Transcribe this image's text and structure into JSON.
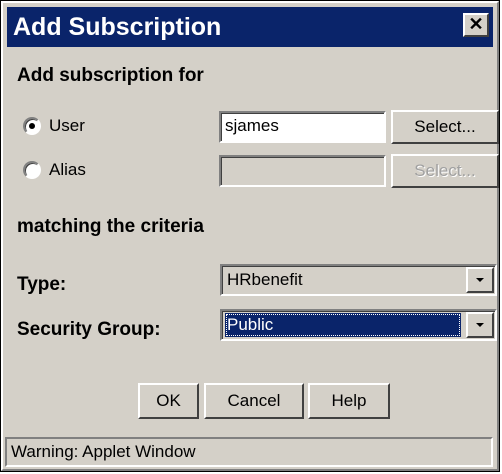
{
  "window": {
    "title": "Add Subscription",
    "close_glyph": "✕"
  },
  "section_add": {
    "heading": "Add subscription for"
  },
  "user_option": {
    "label": "User",
    "selected": true,
    "value": "sjames",
    "select_label": "Select..."
  },
  "alias_option": {
    "label": "Alias",
    "selected": false,
    "value": "",
    "select_label": "Select...",
    "enabled": false
  },
  "section_criteria": {
    "heading": "matching the criteria"
  },
  "type": {
    "label": "Type:",
    "value": "HRbenefit"
  },
  "security_group": {
    "label": "Security Group:",
    "value": "Public",
    "focused": true
  },
  "buttons": {
    "ok": "OK",
    "cancel": "Cancel",
    "help": "Help"
  },
  "status": {
    "text": "Warning: Applet Window"
  },
  "colors": {
    "titlebar": "#0a246a",
    "dialog_face": "#d4d0c8",
    "selection": "#0a246a"
  },
  "icons": {
    "close": "close-icon",
    "dropdown": "chevron-down-icon"
  }
}
